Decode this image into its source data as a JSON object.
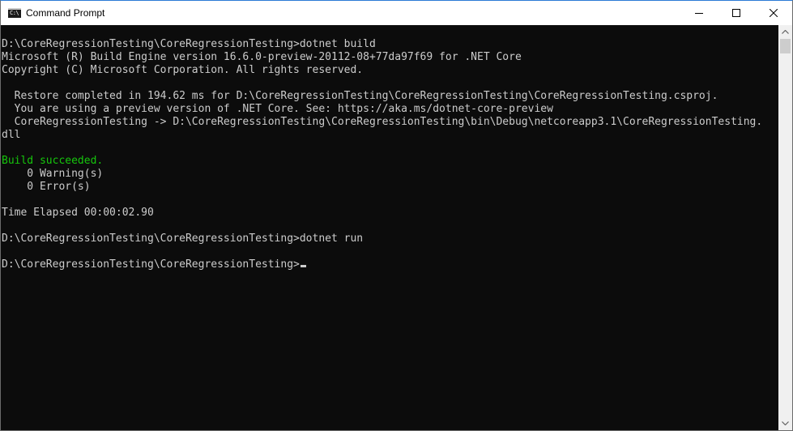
{
  "window": {
    "title": "Command Prompt",
    "icon": "console-app-icon",
    "icon_text": "C:\\"
  },
  "controls": {
    "minimize_icon": "minimize-icon",
    "maximize_icon": "maximize-icon",
    "close_icon": "close-icon"
  },
  "console": {
    "lines": [
      {
        "text": "D:\\CoreRegressionTesting\\CoreRegressionTesting>dotnet build",
        "color": "#cccccc"
      },
      {
        "text": "Microsoft (R) Build Engine version 16.6.0-preview-20112-08+77da97f69 for .NET Core",
        "color": "#cccccc"
      },
      {
        "text": "Copyright (C) Microsoft Corporation. All rights reserved.",
        "color": "#cccccc"
      },
      {
        "text": "",
        "color": "#cccccc"
      },
      {
        "text": "  Restore completed in 194.62 ms for D:\\CoreRegressionTesting\\CoreRegressionTesting\\CoreRegressionTesting.csproj.",
        "color": "#cccccc"
      },
      {
        "text": "  You are using a preview version of .NET Core. See: https://aka.ms/dotnet-core-preview",
        "color": "#cccccc"
      },
      {
        "text": "  CoreRegressionTesting -> D:\\CoreRegressionTesting\\CoreRegressionTesting\\bin\\Debug\\netcoreapp3.1\\CoreRegressionTesting.",
        "color": "#cccccc"
      },
      {
        "text": "dll",
        "color": "#cccccc"
      },
      {
        "text": "",
        "color": "#cccccc"
      },
      {
        "text": "Build succeeded.",
        "color": "#16c60c"
      },
      {
        "text": "    0 Warning(s)",
        "color": "#cccccc"
      },
      {
        "text": "    0 Error(s)",
        "color": "#cccccc"
      },
      {
        "text": "",
        "color": "#cccccc"
      },
      {
        "text": "Time Elapsed 00:00:02.90",
        "color": "#cccccc"
      },
      {
        "text": "",
        "color": "#cccccc"
      },
      {
        "text": "D:\\CoreRegressionTesting\\CoreRegressionTesting>dotnet run",
        "color": "#cccccc"
      },
      {
        "text": "",
        "color": "#cccccc"
      },
      {
        "text": "D:\\CoreRegressionTesting\\CoreRegressionTesting>",
        "color": "#cccccc"
      }
    ],
    "background": "#0c0c0c",
    "foreground": "#cccccc",
    "success_color": "#16c60c"
  },
  "scrollbar": {
    "up_icon": "scroll-up-arrow-icon",
    "down_icon": "scroll-down-arrow-icon"
  }
}
